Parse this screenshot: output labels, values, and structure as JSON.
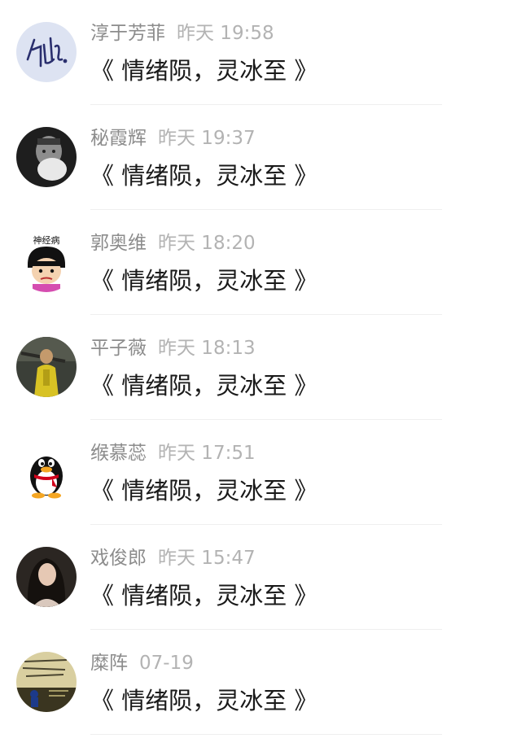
{
  "comments": [
    {
      "name": "淳于芳菲",
      "time": "昨天 19:58",
      "message": "《 情绪陨，灵冰至 》",
      "avatar_icon": "handwriting-avatar"
    },
    {
      "name": "秘霞辉",
      "time": "昨天 19:37",
      "message": "《 情绪陨，灵冰至 》",
      "avatar_icon": "photo-avatar"
    },
    {
      "name": "郭奥维",
      "time": "昨天 18:20",
      "message": "《 情绪陨，灵冰至 》",
      "avatar_icon": "cartoon-avatar",
      "avatar_caption": "神经病"
    },
    {
      "name": "平子薇",
      "time": "昨天 18:13",
      "message": "《 情绪陨，灵冰至 》",
      "avatar_icon": "game-character-avatar"
    },
    {
      "name": "缑慕蕊",
      "time": "昨天 17:51",
      "message": "《 情绪陨，灵冰至 》",
      "avatar_icon": "qq-penguin-avatar"
    },
    {
      "name": "戏俊郎",
      "time": "昨天 15:47",
      "message": "《 情绪陨，灵冰至 》",
      "avatar_icon": "photo-avatar"
    },
    {
      "name": "糜阵",
      "time": "07-19",
      "message": "《 情绪陨，灵冰至 》",
      "avatar_icon": "poster-avatar"
    }
  ],
  "colors": {
    "name": "#8c8c8c",
    "time": "#b3b3b3",
    "message": "#1a1a1a",
    "divider": "#efefef"
  }
}
